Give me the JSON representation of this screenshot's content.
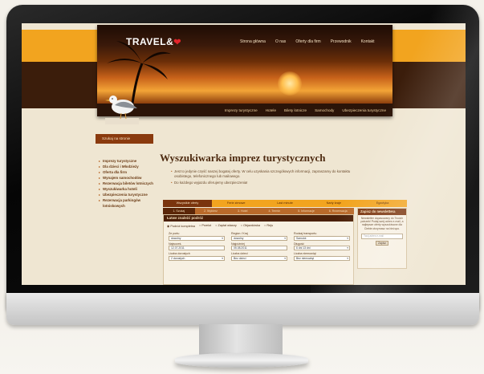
{
  "site": {
    "logo_text": "TRAVEL&",
    "logo_heart": "❤",
    "top_nav": [
      "Strona główna",
      "O nas",
      "Oferty dla firm",
      "Przewodnik",
      "Kontakt"
    ],
    "category_nav": [
      "Imprezy turystyczne",
      "Hotele",
      "Bilety lotnicze",
      "Samochody",
      "Ubezpieczenia turystyczne"
    ],
    "breadcrumb": "Szukaj na stronie",
    "sidebar": [
      "Imprezy turystyczne",
      "Dla dzieci i Młodzieży",
      "Oferta dla firm",
      "Wynajem samochodów",
      "Rezerwacja biletów lotniczych",
      "Wyszukiwarka hoteli",
      "Ubezpieczenia turystyczne",
      "Rezerwacja parkingów lotniskowych"
    ],
    "page_title": "Wyszukiwarka imprez turystycznych",
    "intro": [
      "Jest to jedynie część naszej bogatej oferty. W celu uzyskania szczegółowych informacji, zapraszamy do kontaktu osobistego, telefonicznego lub mailowego.",
      "Do każdego wyjazdu oferujemy ubezpieczenia!"
    ],
    "tabs": [
      "Wszystkie oferty",
      "Ferie zimowe",
      "Last minute",
      "Narty kraje",
      "Egzotyka"
    ],
    "steps": [
      "1. Szukaj",
      "2. Wybierz",
      "3. Hotel",
      "4. Termin",
      "5. Informacje",
      "6. Rezerwacja"
    ],
    "form": {
      "title": "Łatwe znaleźć podróż",
      "radio_options": [
        {
          "label": "Podróż kompletna",
          "selected": true
        },
        {
          "label": "Przelot",
          "selected": false
        },
        {
          "label": "Zapłat własny",
          "selected": false
        },
        {
          "label": "Objazdówka",
          "selected": false
        },
        {
          "label": "Rejs",
          "selected": false
        }
      ],
      "fields": [
        {
          "label": "Ze portu",
          "value": "dowolny"
        },
        {
          "label": "Region / Kraj",
          "value": "dowolny"
        },
        {
          "label": "Rodzaj transportu",
          "value": "Samolot"
        },
        {
          "label": "Najwcześ.",
          "value": "12.07.2011"
        },
        {
          "label": "Najpóźniej",
          "value": "05.08.2011"
        },
        {
          "label": "Długość",
          "value": "6 dni    13 dni"
        },
        {
          "label": "Liczba dorosłych",
          "value": "2 dorosłych"
        },
        {
          "label": "Liczba dzieci",
          "value": "Bez dzieci"
        },
        {
          "label": "Liczba niemowląt",
          "value": "Bez niemowląt"
        }
      ]
    },
    "newsletter": {
      "title": "Zapisz do newslettera",
      "text": "Newsletter dopasowany do Twoich potrzeb! Podaj swój adres e-mail, a najlepsze oferty wyszukiwane dla Ciebie otrzymasz na bieżąco.",
      "placeholder": "Twój adres e-mail",
      "button": "Zapisz"
    }
  },
  "colors": {
    "accent_orange": "#f2a41f",
    "dark_brown": "#3b1d0b",
    "page_bg": "#efe6d2"
  }
}
